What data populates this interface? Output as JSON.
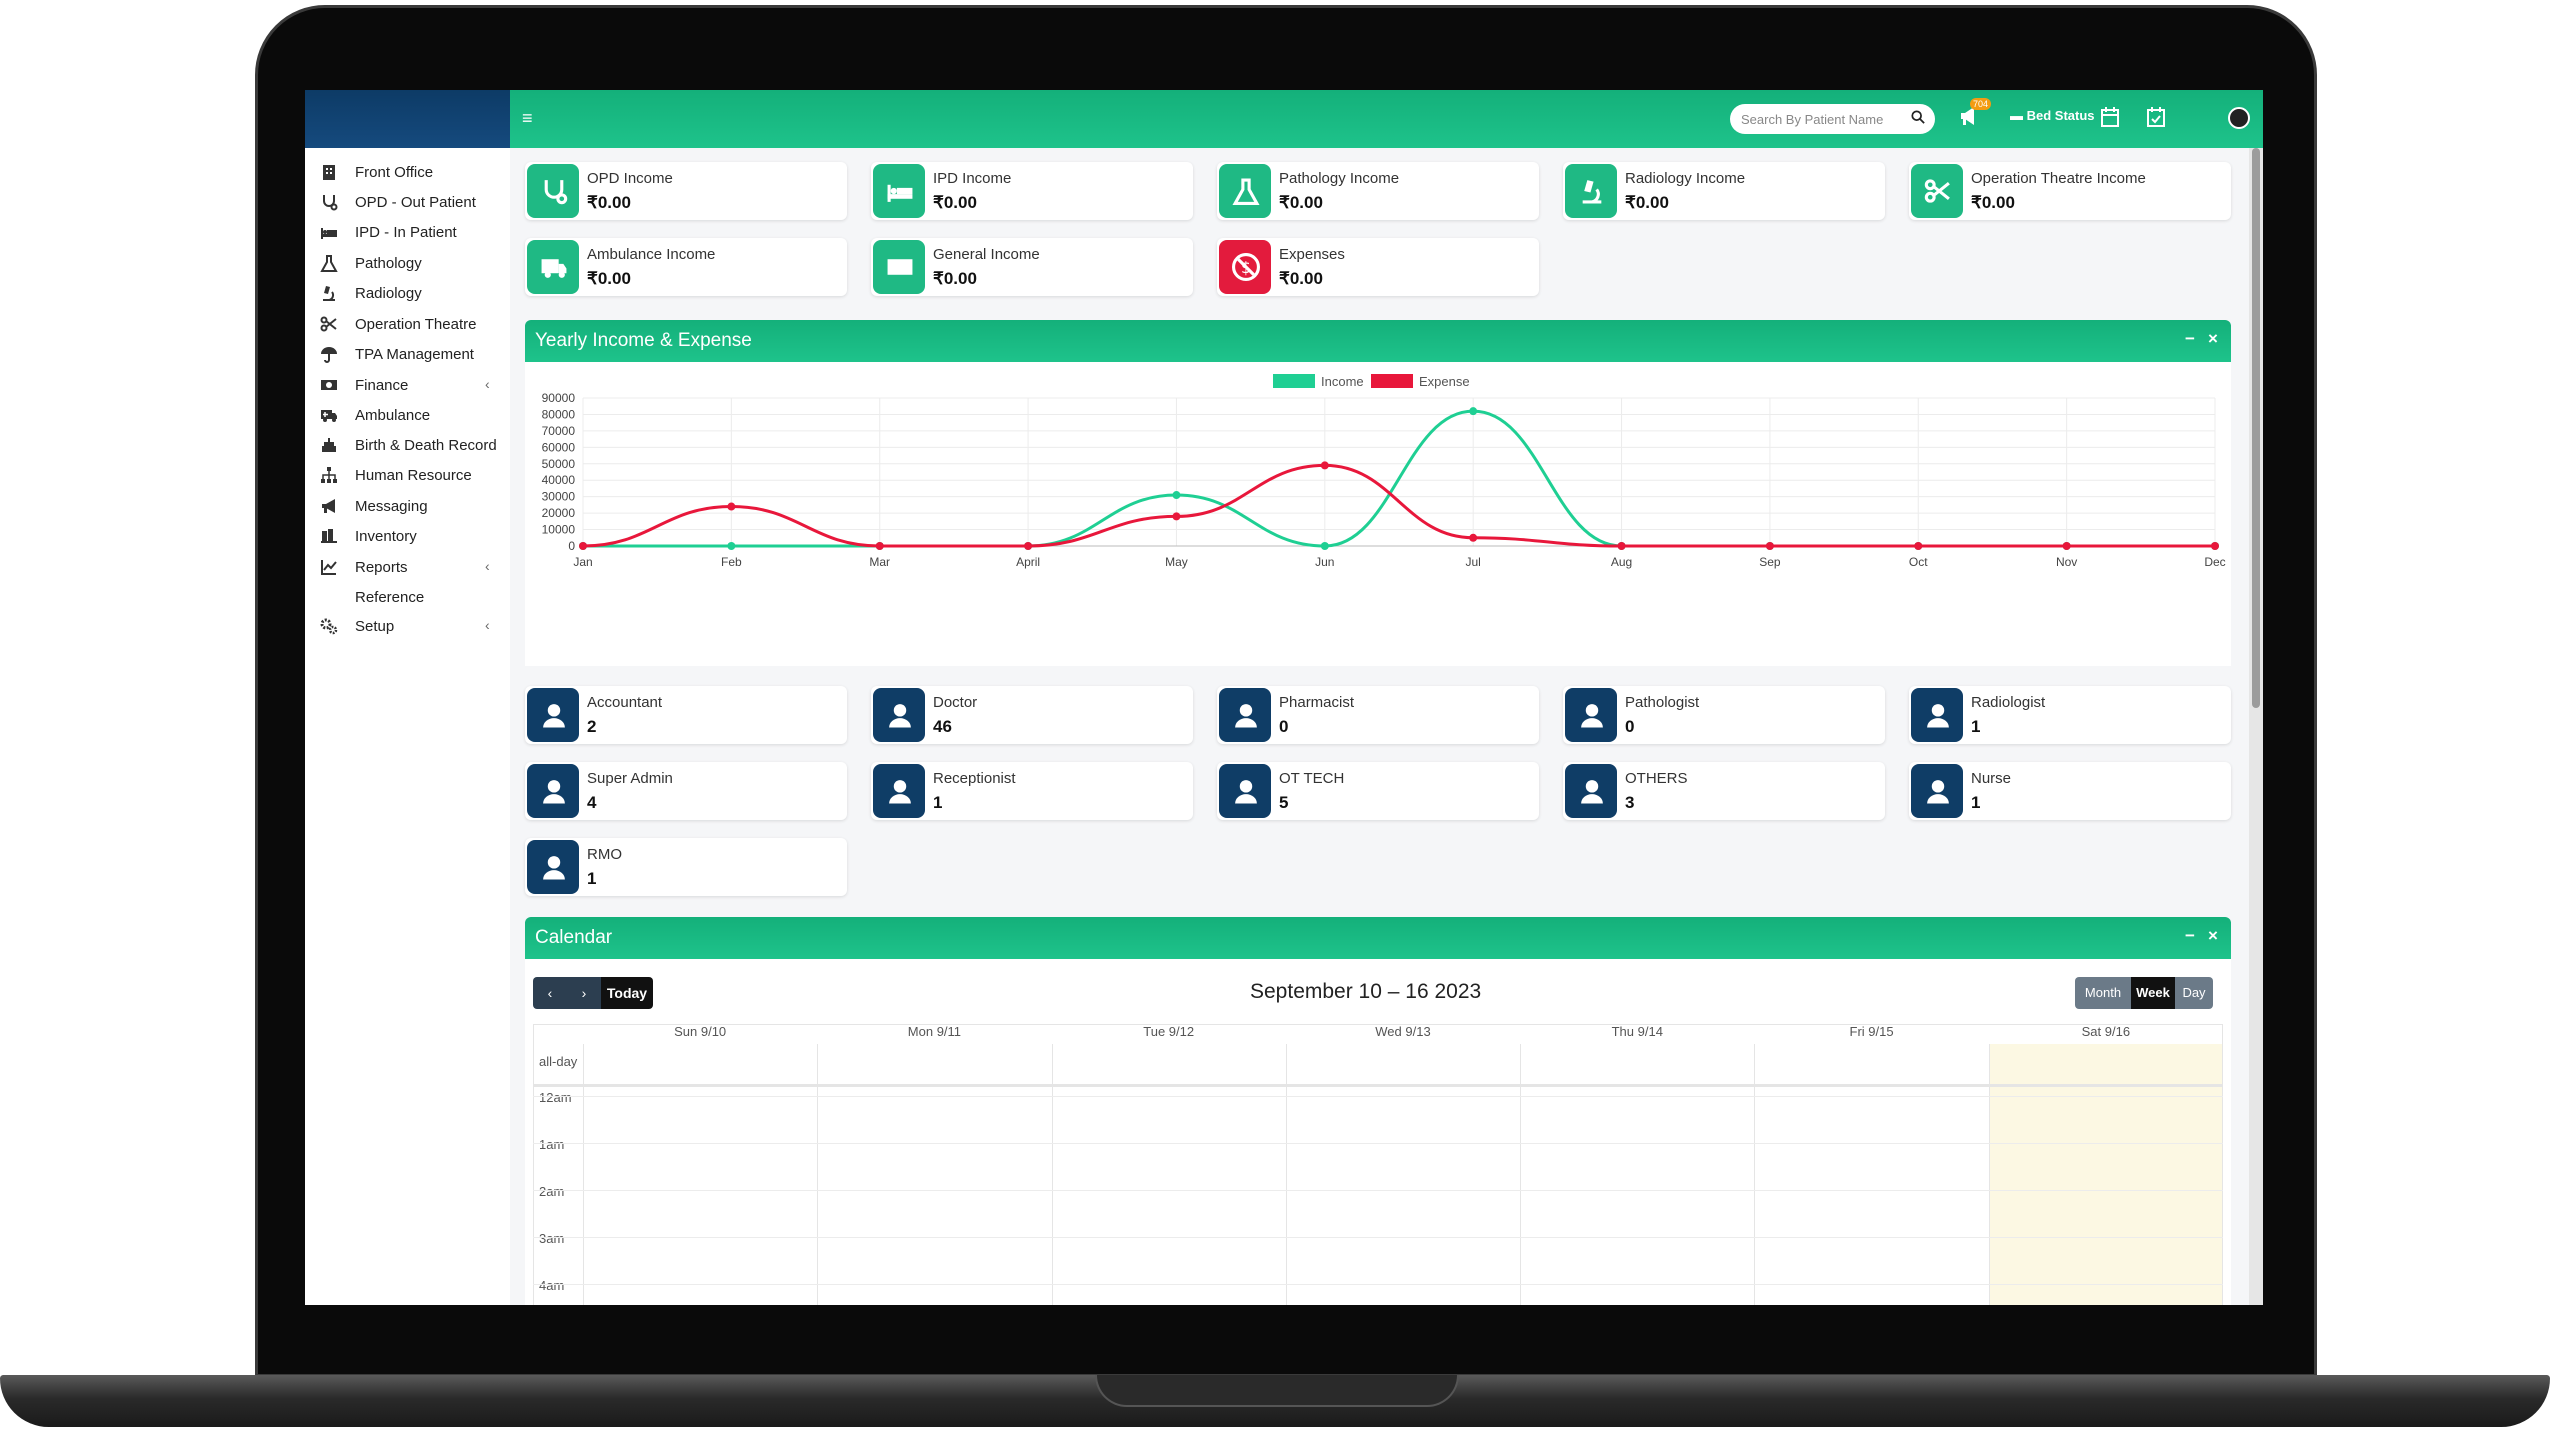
{
  "topbar": {
    "search_placeholder": "Search By Patient Name",
    "notification_count": "704",
    "bed_status_label": "Bed Status"
  },
  "sidebar": {
    "items": [
      {
        "label": "Front Office",
        "icon": "building-icon"
      },
      {
        "label": "OPD - Out Patient",
        "icon": "stethoscope-icon"
      },
      {
        "label": "IPD - In Patient",
        "icon": "bed-icon"
      },
      {
        "label": "Pathology",
        "icon": "flask-icon"
      },
      {
        "label": "Radiology",
        "icon": "microscope-icon"
      },
      {
        "label": "Operation Theatre",
        "icon": "scissors-icon"
      },
      {
        "label": "TPA Management",
        "icon": "umbrella-icon"
      },
      {
        "label": "Finance",
        "icon": "money-icon",
        "arrow": "‹"
      },
      {
        "label": "Ambulance",
        "icon": "ambulance-icon"
      },
      {
        "label": "Birth & Death Record",
        "icon": "birth-death-icon"
      },
      {
        "label": "Human Resource",
        "icon": "sitemap-icon"
      },
      {
        "label": "Messaging",
        "icon": "bullhorn-icon"
      },
      {
        "label": "Inventory",
        "icon": "inventory-icon"
      },
      {
        "label": "Reports",
        "icon": "line-chart-icon",
        "arrow": "‹"
      },
      {
        "label": "Reference",
        "icon": ""
      },
      {
        "label": "Setup",
        "icon": "gears-icon",
        "arrow": "‹"
      }
    ]
  },
  "income_cards": [
    {
      "label": "OPD Income",
      "value": "₹0.00",
      "icon": "stethoscope-icon",
      "color": "green"
    },
    {
      "label": "IPD Income",
      "value": "₹0.00",
      "icon": "bed-icon",
      "color": "green"
    },
    {
      "label": "Pathology Income",
      "value": "₹0.00",
      "icon": "flask-icon",
      "color": "green"
    },
    {
      "label": "Radiology Income",
      "value": "₹0.00",
      "icon": "microscope-icon",
      "color": "green"
    },
    {
      "label": "Operation Theatre Income",
      "value": "₹0.00",
      "icon": "scissors-icon",
      "color": "green"
    },
    {
      "label": "Ambulance Income",
      "value": "₹0.00",
      "icon": "ambulance-icon",
      "color": "green"
    },
    {
      "label": "General Income",
      "value": "₹0.00",
      "icon": "money-icon",
      "color": "green"
    },
    {
      "label": "Expenses",
      "value": "₹0.00",
      "icon": "expense-icon",
      "color": "red"
    }
  ],
  "chart_panel": {
    "title": "Yearly Income & Expense",
    "minimize": "−",
    "close": "×"
  },
  "chart_data": {
    "type": "line",
    "categories": [
      "Jan",
      "Feb",
      "Mar",
      "April",
      "May",
      "Jun",
      "Jul",
      "Aug",
      "Sep",
      "Oct",
      "Nov",
      "Dec"
    ],
    "series": [
      {
        "name": "Income",
        "color": "#1fcf93",
        "values": [
          0,
          0,
          0,
          0,
          31000,
          0,
          82000,
          0,
          0,
          0,
          0,
          0
        ]
      },
      {
        "name": "Expense",
        "color": "#e8173b",
        "values": [
          0,
          24000,
          0,
          0,
          18000,
          49000,
          5000,
          0,
          0,
          0,
          0,
          0
        ]
      }
    ],
    "ylim": [
      0,
      90000
    ],
    "yticks": [
      0,
      10000,
      20000,
      30000,
      40000,
      50000,
      60000,
      70000,
      80000,
      90000
    ],
    "legend": "top-center",
    "grid": true
  },
  "staff_cards": [
    {
      "label": "Accountant",
      "value": "2"
    },
    {
      "label": "Doctor",
      "value": "46"
    },
    {
      "label": "Pharmacist",
      "value": "0"
    },
    {
      "label": "Pathologist",
      "value": "0"
    },
    {
      "label": "Radiologist",
      "value": "1"
    },
    {
      "label": "Super Admin",
      "value": "4"
    },
    {
      "label": "Receptionist",
      "value": "1"
    },
    {
      "label": "OT TECH",
      "value": "5"
    },
    {
      "label": "OTHERS",
      "value": "3"
    },
    {
      "label": "Nurse",
      "value": "1"
    },
    {
      "label": "RMO",
      "value": "1"
    }
  ],
  "calendar": {
    "title": "Calendar",
    "minimize": "−",
    "close": "×",
    "range": "September 10 – 16 2023",
    "prev": "‹",
    "next": "›",
    "today": "Today",
    "views": [
      "Month",
      "Week",
      "Day"
    ],
    "active_view": "Week",
    "days": [
      "Sun 9/10",
      "Mon 9/11",
      "Tue 9/12",
      "Wed 9/13",
      "Thu 9/14",
      "Fri 9/15",
      "Sat 9/16"
    ],
    "allday": "all-day",
    "times": [
      "12am",
      "1am",
      "2am",
      "3am",
      "4am"
    ]
  }
}
